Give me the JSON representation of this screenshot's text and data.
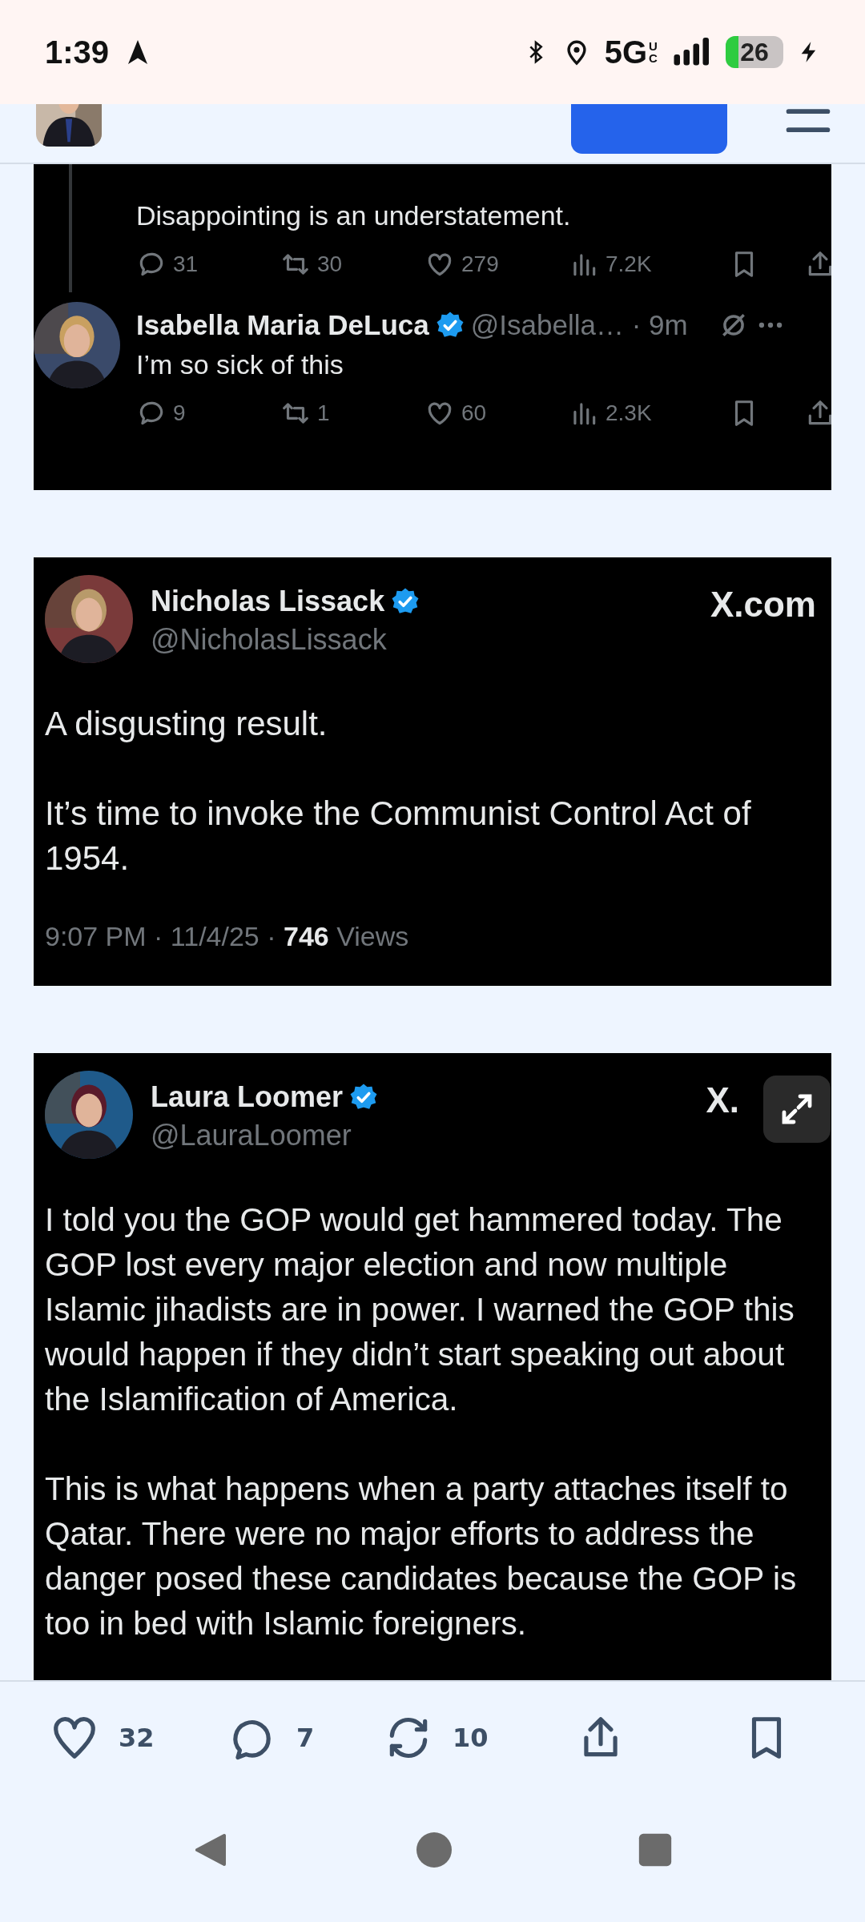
{
  "status_bar": {
    "time": "1:39",
    "network": "5G",
    "network_sub": "UC",
    "battery": "26",
    "charging": true
  },
  "embeds": [
    {
      "kind": "thread",
      "text": "Disappointing is an understatement.",
      "stats": [
        "31",
        "30",
        "279",
        "7.2K"
      ],
      "reply": {
        "name": "Isabella Maria DeLuca",
        "verified": true,
        "handle": "@Isabella… · 9m",
        "text": "I’m so sick of this",
        "stats": [
          "9",
          "1",
          "60",
          "2.3K"
        ]
      }
    },
    {
      "kind": "card",
      "name": "Nicholas Lissack",
      "verified": true,
      "handle": "@NicholasLissack",
      "brand": "X.com",
      "paragraphs": [
        "A disgusting result.",
        "It’s time to invoke the Communist Control Act of 1954."
      ],
      "meta": "9:07 PM · 11/4/25 · **746** Views"
    },
    {
      "kind": "card",
      "name": "Laura Loomer",
      "verified": true,
      "handle": "@LauraLoomer",
      "brand": "X.",
      "expand": true,
      "paragraphs": [
        "I told you the GOP would get hammered today. The GOP lost every major election and now multiple Islamic jihadists are in power. I warned the GOP this would happen if they didn’t start speaking out about the Islamification of America.",
        "This is what happens when a party attaches itself to Qatar. There were no major efforts to address the danger posed these candidates because the GOP is too in bed with Islamic foreigners."
      ]
    }
  ],
  "actions": [
    {
      "kind": "like",
      "count": "32"
    },
    {
      "kind": "comment",
      "count": "7"
    },
    {
      "kind": "repost",
      "count": "10"
    },
    {
      "kind": "share"
    },
    {
      "kind": "bookmark"
    }
  ]
}
